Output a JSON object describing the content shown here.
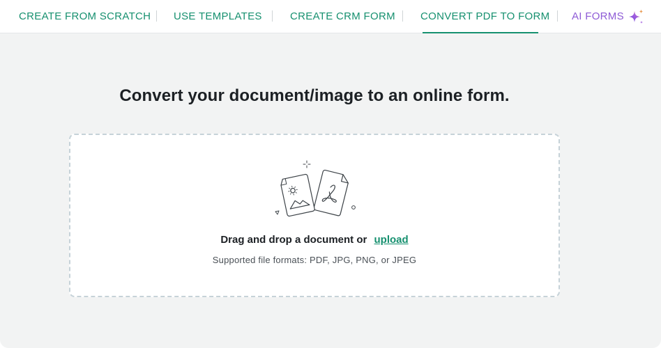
{
  "tabs": [
    {
      "label": "CREATE FROM SCRATCH"
    },
    {
      "label": "USE TEMPLATES"
    },
    {
      "label": "CREATE CRM FORM"
    },
    {
      "label": "CONVERT PDF TO FORM",
      "active": true
    },
    {
      "label": "AI FORMS"
    }
  ],
  "ai_icon": "sparkle-icon",
  "main": {
    "heading": "Convert your document/image to an online form.",
    "dropzone": {
      "illustration_icon": "document-image-pdf-icon",
      "prompt": "Drag and drop a document or",
      "upload_link": "upload",
      "formats": "Supported file formats: PDF, JPG, PNG, or JPEG"
    }
  },
  "colors": {
    "accent": "#16906f",
    "ai_purple": "#8e5bd6",
    "background": "#f2f3f3",
    "dropzone_border": "#c6d2d8"
  }
}
